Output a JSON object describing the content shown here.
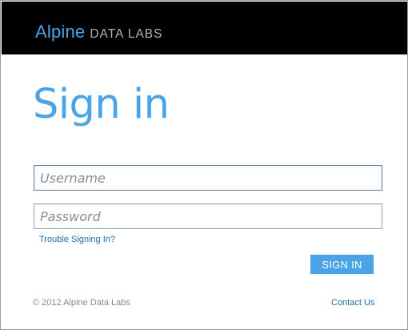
{
  "header": {
    "brand_main": "Alpine",
    "brand_sub": "DATA LABS"
  },
  "main": {
    "title": "Sign in",
    "username_placeholder": "Username",
    "username_value": "",
    "password_placeholder": "Password",
    "password_value": "",
    "trouble_link": "Trouble Signing In?",
    "sign_in_button": "SIGN IN"
  },
  "footer": {
    "copyright": "© 2012 Alpine Data Labs",
    "contact_link": "Contact Us"
  },
  "colors": {
    "brand_blue": "#4aa3e6",
    "header_bg": "#000000",
    "link_blue": "#1f6fa9",
    "muted_text": "#8a8a8a"
  }
}
